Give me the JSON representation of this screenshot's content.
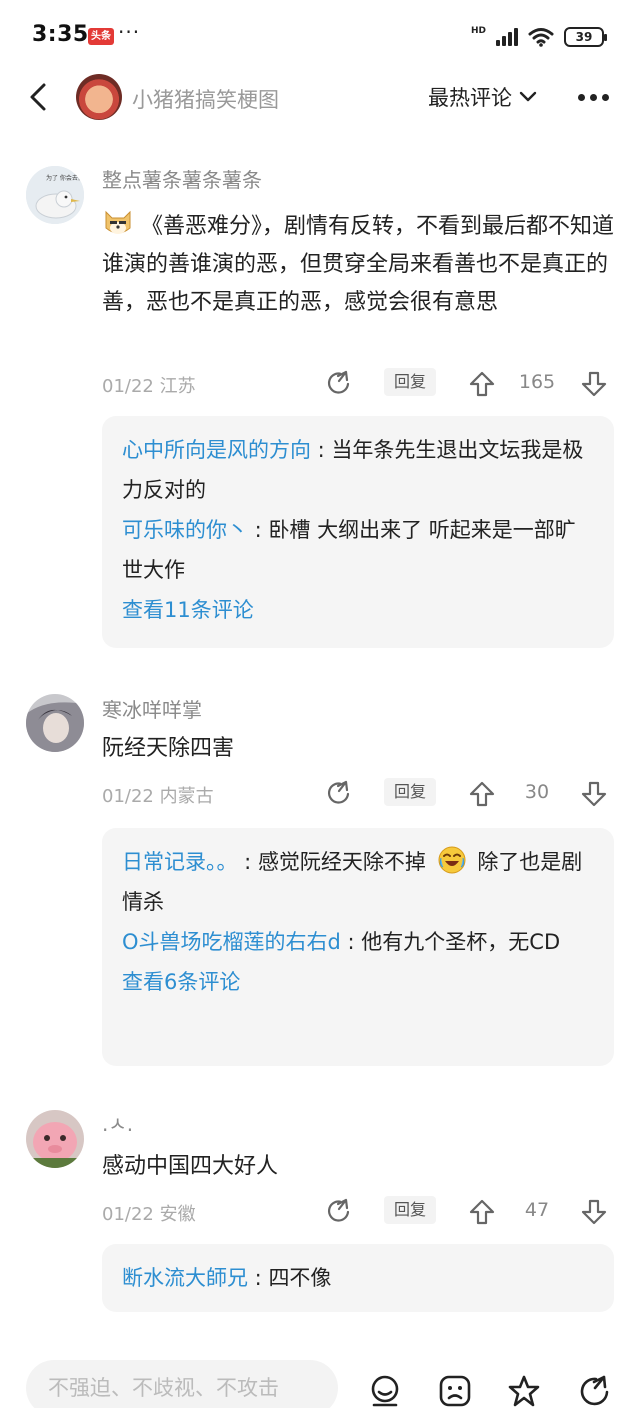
{
  "status_bar": {
    "time": "3:35",
    "app_badge": "头条",
    "more": "···",
    "network": "HD",
    "battery": "39"
  },
  "header": {
    "title": "小猪猪搞笑梗图",
    "sort_label": "最热评论"
  },
  "comments": [
    {
      "user": "整点薯条薯条薯条",
      "avatar_caption": "为了 你会去做头 整点薯条",
      "text": "《善恶难分》，剧情有反转，不看到最后都不知道谁演的善谁演的恶，但贯穿全局来看善也不是真正的善，恶也不是真正的恶，感觉会很有意思",
      "date": "01/22 江苏",
      "reply_label": "回复",
      "votes": "165",
      "replies": [
        {
          "name": "心中所向是风的方向",
          "sep": " : ",
          "text": "当年条先生退出文坛我是极力反对的"
        },
        {
          "name": "可乐味的你丶",
          "sep": " : ",
          "text": "卧槽 大纲出来了 听起来是一部旷世大作"
        }
      ],
      "view_more": "查看11条评论"
    },
    {
      "user": "寒冰咩咩掌",
      "text": "阮经天除四害",
      "date": "01/22 内蒙古",
      "reply_label": "回复",
      "votes": "30",
      "replies": [
        {
          "name": "日常记录。。",
          "sep": " : ",
          "text_before": "感觉阮经天除不掉",
          "text": "除了也是剧情杀"
        },
        {
          "name": "O斗兽场吃榴莲的右右d",
          "sep": " : ",
          "text": "他有九个圣杯，无CD"
        }
      ],
      "view_more": "查看6条评论"
    },
    {
      "user": ".ㅅ.",
      "text": "感动中国四大好人",
      "date": "01/22 安徽",
      "reply_label": "回复",
      "votes": "47",
      "replies": [
        {
          "name": "断水流大師兄",
          "sep": " : ",
          "text": "四不像"
        }
      ]
    }
  ],
  "bottom_bar": {
    "input_placeholder": "不强迫、不歧视、不攻击"
  },
  "colors": {
    "link": "#2d8ed1",
    "reply_bg": "#f5f5f5",
    "muted": "#8a8a8a"
  }
}
